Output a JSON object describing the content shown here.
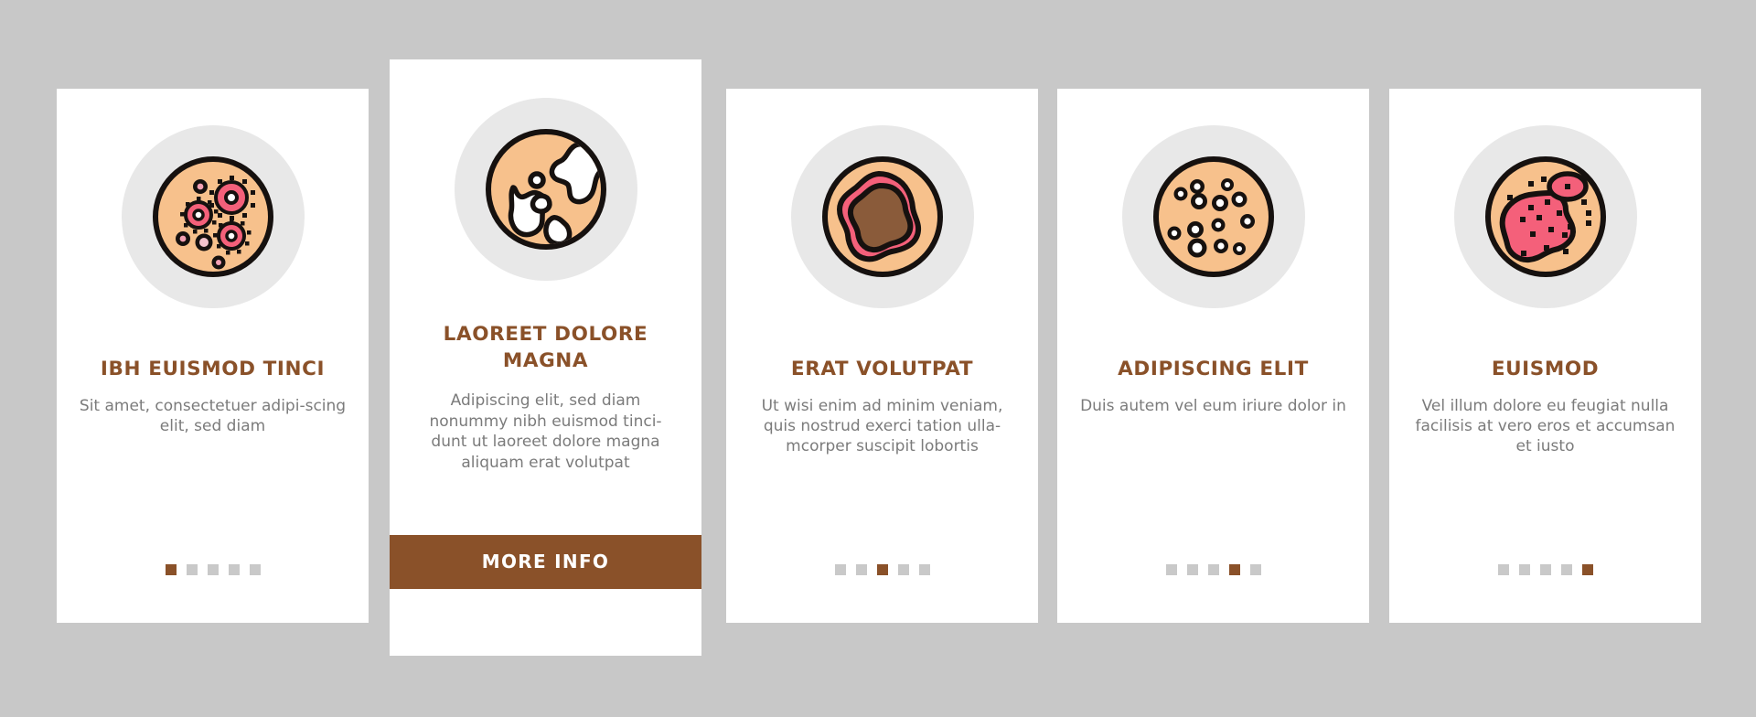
{
  "page": {
    "background_color": "#c8c8c8",
    "card_background": "#ffffff",
    "accent_color": "#8a5129",
    "body_text_color": "#7b7b7b",
    "dot_inactive_color": "#c9c9c9",
    "icon_circle_color": "#e8e8e8",
    "skin_color": "#f7c18c",
    "lesion_pink": "#f4607a",
    "mole_brown": "#8a5b3a",
    "outline_color": "#16110f"
  },
  "cards": [
    {
      "id": "card-1",
      "icon_name": "skin-germs-icon",
      "title": "IBH EUISMOD TINCI",
      "body": "Sit amet, consectetuer adipi-scing elit, sed diam",
      "dots": {
        "count": 5,
        "active_index": 0
      },
      "featured": false,
      "cta": null
    },
    {
      "id": "card-2",
      "icon_name": "skin-vitiligo-icon",
      "title": "LAOREET DOLORE MAGNA",
      "body": "Adipiscing elit, sed diam nonummy nibh euismod tinci-dunt ut laoreet dolore magna aliquam erat volutpat",
      "dots": null,
      "featured": true,
      "cta": "MORE INFO"
    },
    {
      "id": "card-3",
      "icon_name": "skin-mole-melanoma-icon",
      "title": "ERAT VOLUTPAT",
      "body": "Ut wisi enim ad minim veniam, quis nostrud exerci tation ulla-mcorper suscipit lobortis",
      "dots": {
        "count": 5,
        "active_index": 2
      },
      "featured": false,
      "cta": null
    },
    {
      "id": "card-4",
      "icon_name": "skin-pores-icon",
      "title": "ADIPISCING ELIT",
      "body": "Duis autem vel eum iriure dolor in",
      "dots": {
        "count": 5,
        "active_index": 3
      },
      "featured": false,
      "cta": null
    },
    {
      "id": "card-5",
      "icon_name": "skin-rash-icon",
      "title": "EUISMOD",
      "body": "Vel illum dolore eu feugiat nulla facilisis at vero eros et accumsan et iusto",
      "dots": {
        "count": 5,
        "active_index": 4
      },
      "featured": false,
      "cta": null
    }
  ]
}
